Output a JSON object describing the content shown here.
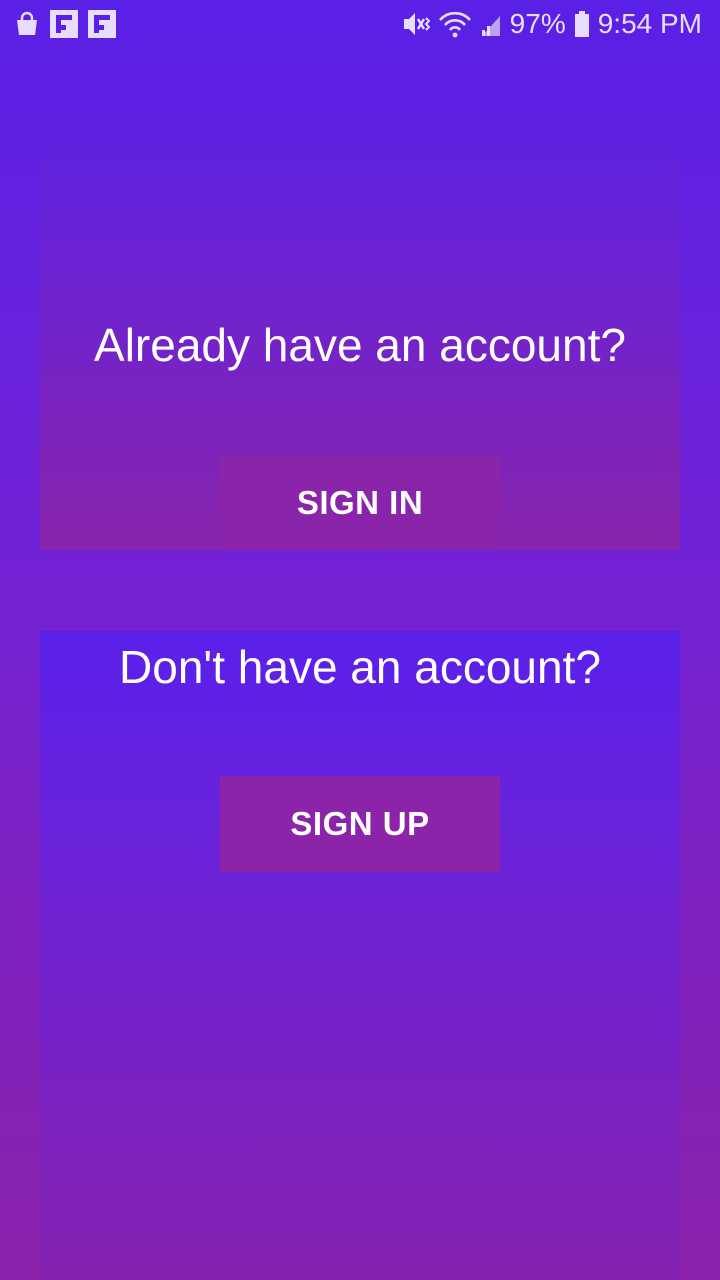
{
  "status_bar": {
    "battery_percent": "97%",
    "time": "9:54 PM",
    "icons_left": [
      "shopping-bag-icon",
      "flipboard-icon",
      "flipboard-icon"
    ],
    "icons_right": [
      "mute-vibrate-icon",
      "wifi-icon",
      "signal-icon",
      "battery-icon"
    ]
  },
  "signin_card": {
    "title": "Already have an account?",
    "button_label": "SIGN IN"
  },
  "signup_card": {
    "title": "Don't have an account?",
    "button_label": "SIGN UP"
  },
  "colors": {
    "background_top": "#5a20e6",
    "background_bottom": "#8b22ab",
    "button": "#8b24a8",
    "text": "#ffffff"
  }
}
